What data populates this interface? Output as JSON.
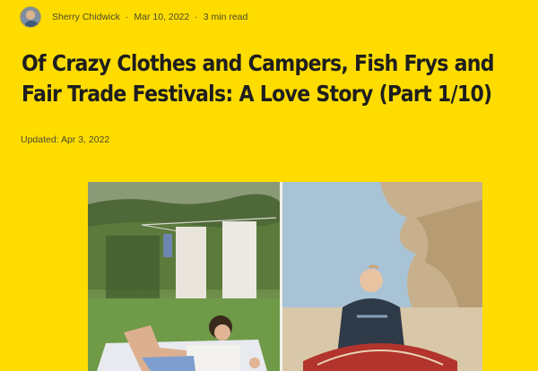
{
  "author": {
    "name": "Sherry Chidwick",
    "date": "Mar 10, 2022",
    "read_time": "3 min read"
  },
  "separator": "·",
  "article": {
    "title": "Of Crazy Clothes and Campers, Fish Frys and Fair Trade Festivals: A Love Story (Part 1/10)",
    "updated": "Updated: Apr 3, 2022"
  },
  "colors": {
    "background": "#FFDC00",
    "title": "#1e1e1e",
    "meta": "#4a4a2a"
  }
}
